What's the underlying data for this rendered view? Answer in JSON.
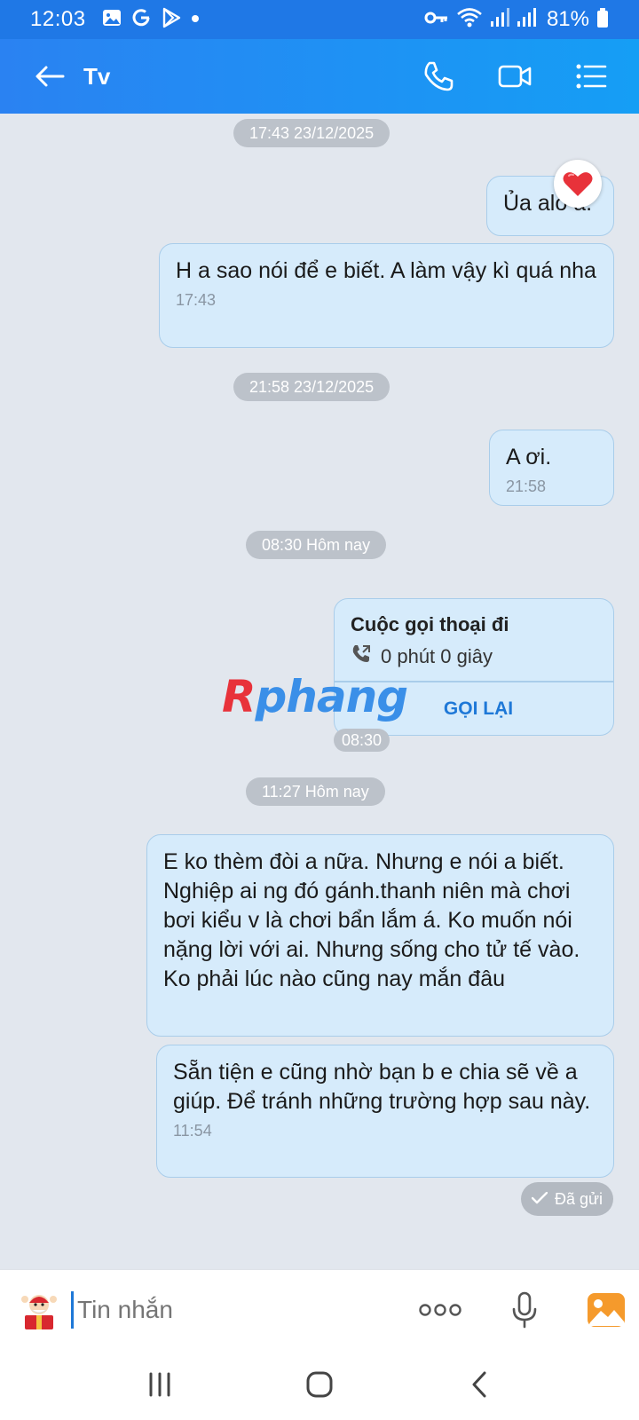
{
  "status_bar": {
    "time": "12:03",
    "battery": "81%",
    "left_icons": [
      "image-icon",
      "google-icon",
      "play-store-icon",
      "dot-icon"
    ],
    "right_icons": [
      "key-icon",
      "wifi-icon",
      "signal-icon",
      "signal-icon",
      "battery-icon"
    ]
  },
  "header": {
    "title": "Tv",
    "icons": [
      "back-arrow-icon",
      "phone-icon",
      "video-call-icon",
      "menu-list-icon"
    ]
  },
  "chat": {
    "separators": [
      "17:43 23/12/2025",
      "21:58 23/12/2025",
      "08:30 Hôm nay",
      "11:27 Hôm nay"
    ],
    "messages": [
      {
        "text": "Ủa alo a.",
        "reaction": "heart"
      },
      {
        "text": "H a sao nói để e biết. A làm vậy kì quá nha",
        "time": "17:43"
      },
      {
        "text": "A ơi.",
        "time": "21:58"
      },
      {
        "text": "E ko thèm đòi a nữa. Nhưng e nói a biết. Nghiệp ai ng đó gánh.thanh niên mà chơi bơi kiểu v là chơi bẩn lắm á. Ko muốn nói nặng lời với ai. Nhưng sống cho tử tế vào. Ko phải lúc nào cũng nay mắn đâu"
      },
      {
        "text": "Sẵn tiện e cũng nhờ bạn b e chia sẽ về a giúp. Để tránh những trường hợp sau này.",
        "time": "11:54"
      }
    ],
    "call": {
      "title": "Cuộc gọi thoại đi",
      "duration": "0 phút 0 giây",
      "action": "GỌI LẠI",
      "time": "08:30"
    },
    "watermark": {
      "first": "R",
      "rest": "phang"
    },
    "sent_status": "Đã gửi"
  },
  "input": {
    "placeholder": "Tin nhắn",
    "icons": [
      "sticker-icon",
      "more-icon",
      "microphone-icon",
      "gallery-icon"
    ]
  },
  "navbar": {
    "icons": [
      "recent-apps-icon",
      "home-icon",
      "back-icon"
    ]
  },
  "colors": {
    "header": "#1f78e6",
    "bubble": "#d6ebfb",
    "bubble_border": "#a9cdea",
    "background": "#e2e7ee",
    "accent": "#1e78d7",
    "heart": "#e8323a"
  }
}
